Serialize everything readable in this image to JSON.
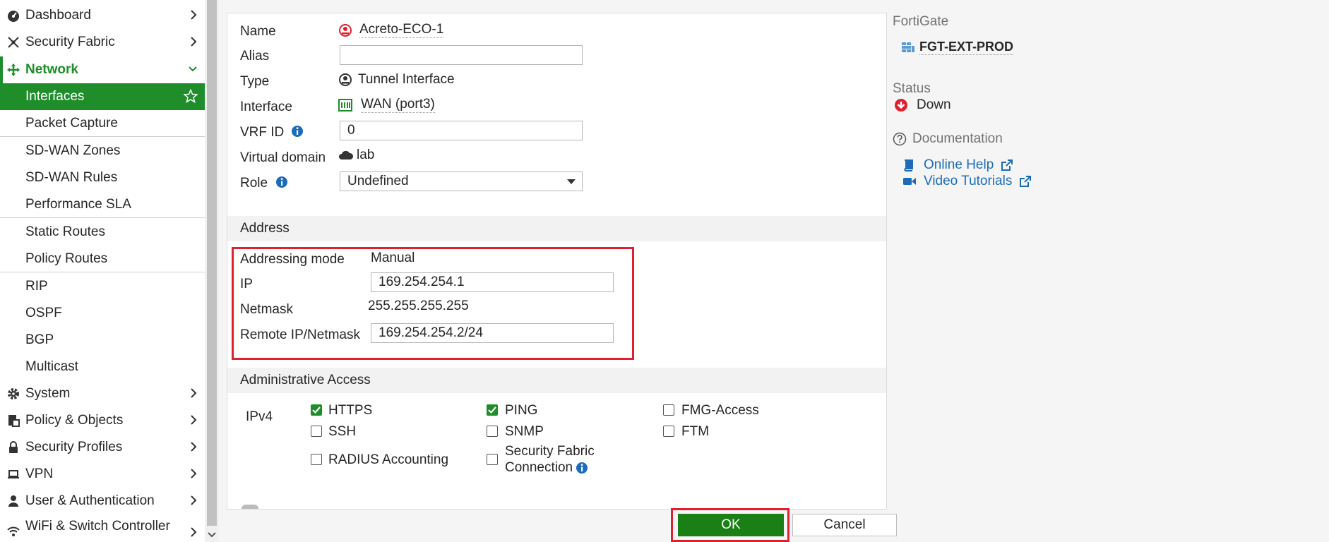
{
  "sidebar": {
    "items": [
      {
        "label": "Dashboard",
        "icon": "dashboard-icon"
      },
      {
        "label": "Security Fabric",
        "icon": "security-fabric-icon"
      },
      {
        "label": "Network",
        "icon": "network-icon"
      },
      {
        "label": "Interfaces"
      },
      {
        "label": "Packet Capture"
      },
      {
        "label": "SD-WAN Zones"
      },
      {
        "label": "SD-WAN Rules"
      },
      {
        "label": "Performance SLA"
      },
      {
        "label": "Static Routes"
      },
      {
        "label": "Policy Routes"
      },
      {
        "label": "RIP"
      },
      {
        "label": "OSPF"
      },
      {
        "label": "BGP"
      },
      {
        "label": "Multicast"
      },
      {
        "label": "System",
        "icon": "gear-icon"
      },
      {
        "label": "Policy & Objects",
        "icon": "policy-icon"
      },
      {
        "label": "Security Profiles",
        "icon": "lock-icon"
      },
      {
        "label": "VPN",
        "icon": "laptop-icon"
      },
      {
        "label": "User & Authentication",
        "icon": "user-icon"
      },
      {
        "label": "WiFi & Switch Controller",
        "icon": "wifi-icon"
      }
    ]
  },
  "form": {
    "name_label": "Name",
    "name_value": "Acreto-ECO-1",
    "alias_label": "Alias",
    "alias_value": "",
    "type_label": "Type",
    "type_value": "Tunnel Interface",
    "interface_label": "Interface",
    "interface_value": "WAN (port3)",
    "vrf_label": "VRF ID",
    "vrf_value": "0",
    "vdom_label": "Virtual domain",
    "vdom_value": "lab",
    "role_label": "Role",
    "role_value": "Undefined"
  },
  "address": {
    "section_title": "Address",
    "mode_label": "Addressing mode",
    "mode_value": "Manual",
    "ip_label": "IP",
    "ip_value": "169.254.254.1",
    "netmask_label": "Netmask",
    "netmask_value": "255.255.255.255",
    "remote_label": "Remote IP/Netmask",
    "remote_value": "169.254.254.2/24"
  },
  "admin": {
    "section_title": "Administrative Access",
    "ipv4_label": "IPv4",
    "options": [
      {
        "label": "HTTPS",
        "checked": true
      },
      {
        "label": "PING",
        "checked": true
      },
      {
        "label": "FMG-Access",
        "checked": false
      },
      {
        "label": "SSH",
        "checked": false
      },
      {
        "label": "SNMP",
        "checked": false
      },
      {
        "label": "FTM",
        "checked": false
      },
      {
        "label": "RADIUS Accounting",
        "checked": false
      },
      {
        "label": "Security Fabric Connection",
        "checked": false
      }
    ],
    "sfc_line1": "Security Fabric",
    "sfc_line2": "Connection"
  },
  "buttons": {
    "ok": "OK",
    "cancel": "Cancel"
  },
  "info": {
    "fortigate_label": "FortiGate",
    "device_name": "FGT-EXT-PROD",
    "status_label": "Status",
    "status_value": "Down",
    "documentation_label": "Documentation",
    "online_help": "Online Help",
    "video_tutorials": "Video Tutorials"
  },
  "colors": {
    "accent_green": "#1e8d2a",
    "highlight_red": "#e0202e",
    "link_blue": "#1c6bb8"
  }
}
